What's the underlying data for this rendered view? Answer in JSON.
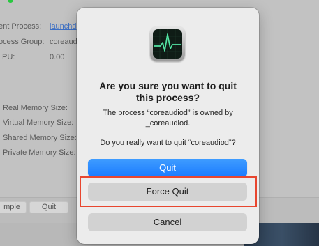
{
  "background": {
    "parent_process_label": "ent Process:",
    "parent_process_value": "launchd",
    "process_group_label": "ocess Group:",
    "process_group_value": "coreaudiod",
    "cpu_label": "PU:",
    "cpu_value": "0.00",
    "real_memory_label": "Real Memory Size:",
    "virtual_memory_label": "Virtual Memory Size:",
    "shared_memory_label": "Shared Memory Size:",
    "private_memory_label": "Private Memory Size:",
    "sample_button": "mple",
    "quit_button": "Quit"
  },
  "dialog": {
    "icon": "activity-monitor-icon",
    "title_line1": "Are you sure you want to quit",
    "title_line2": "this process?",
    "message_line1": "The process “coreaudiod” is owned by",
    "message_line2": "_coreaudiod.",
    "question": "Do you really want to quit “coreaudiod”?",
    "quit_label": "Quit",
    "force_quit_label": "Force Quit",
    "cancel_label": "Cancel"
  },
  "colors": {
    "accent": "#1a7bff",
    "highlight": "#e8462f"
  }
}
